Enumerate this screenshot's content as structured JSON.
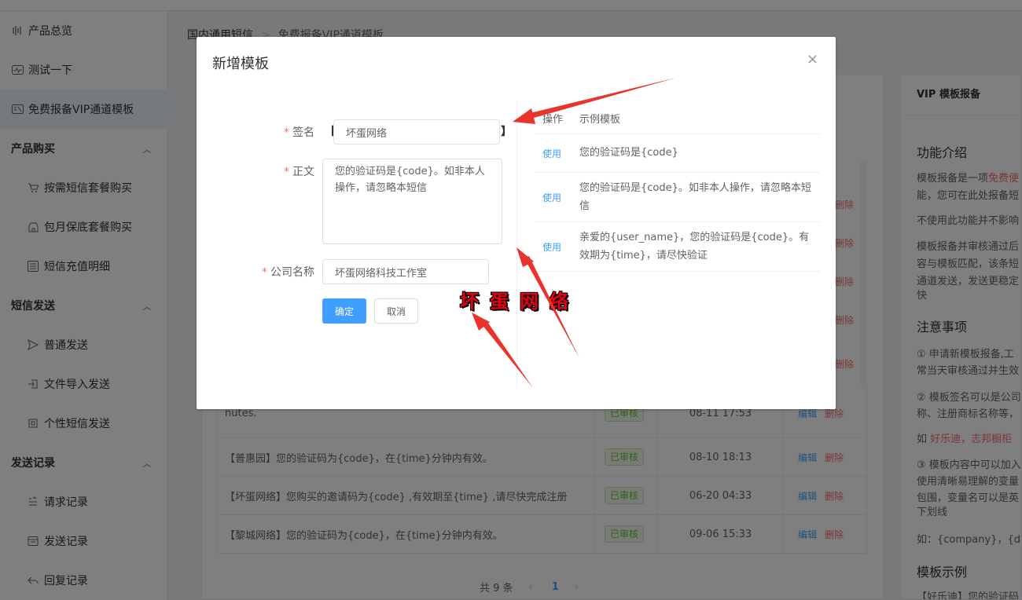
{
  "sidebar": {
    "items": [
      {
        "label": "产品总览",
        "icon": "bars-icon"
      },
      {
        "label": "测试一下",
        "icon": "pulse-icon"
      },
      {
        "label": "免费报备VIP通道模板",
        "icon": "template-icon"
      }
    ],
    "groups": [
      {
        "label": "产品购买",
        "items": [
          {
            "label": "按需短信套餐购买"
          },
          {
            "label": "包月保底套餐购买"
          },
          {
            "label": "短信充值明细"
          }
        ]
      },
      {
        "label": "短信发送",
        "items": [
          {
            "label": "普通发送"
          },
          {
            "label": "文件导入发送"
          },
          {
            "label": "个性短信发送"
          }
        ]
      },
      {
        "label": "发送记录",
        "items": [
          {
            "label": "请求记录"
          },
          {
            "label": "发送记录"
          },
          {
            "label": "回复记录"
          }
        ]
      }
    ]
  },
  "breadcrumb": {
    "root": "国内通用短信",
    "sep": ">",
    "current": "免费报备VIP通道模板"
  },
  "table": {
    "rows": [
      {
        "content": "nutes.",
        "status": "已审核",
        "time": "08-11 17:53",
        "edit": "编辑",
        "del": "删除"
      },
      {
        "content": "【普惠园】您的验证码为{code}，在{time}分钟内有效。",
        "status": "已审核",
        "time": "08-10 18:13",
        "edit": "编辑",
        "del": "删除"
      },
      {
        "content": "【坏蛋网络】您购买的邀请码为{code} ,有效期至{time} ,请尽快完成注册",
        "status": "已审核",
        "time": "06-20 04:33",
        "edit": "编辑",
        "del": "删除"
      },
      {
        "content": "【黎城网络】您的验证码为{code}，在{time}分钟内有效。",
        "status": "已审核",
        "time": "09-06 15:33",
        "edit": "编辑",
        "del": "删除"
      }
    ],
    "hidden_del": "删除"
  },
  "pagination": {
    "total": "共 9 条",
    "prev": "‹",
    "page": "1",
    "next": "›"
  },
  "right_panel": {
    "title": "VIP 模板报备",
    "intro_h": "功能介绍",
    "intro_1a": "模板报备是一项",
    "intro_1b": "免费便",
    "intro_1c": "能，您可在此处报备短",
    "intro_2": "不使用此功能并不影响",
    "intro_3a": "模板报备并审核通过后",
    "intro_3b": "容与模板匹配，该条短",
    "intro_3c": "通道发送，发送更稳定",
    "intro_3d": "快",
    "notes_h": "注意事项",
    "note_1a": "① 申请新模板报备,工",
    "note_1b": "常当天审核通过并生效",
    "note_2a": "② 模板签名可以是公司",
    "note_2b": "称、注册商标名称等，",
    "note_2c_prefix": "如",
    "note_2c_red": "好乐迪，志邦橱柜",
    "note_3a": "③ 模板内容中可以加入",
    "note_3b": "使用清晰易理解的变量",
    "note_3c": "包围，变量名可以是英",
    "note_3d": "下划线",
    "note_4": "如：{company}，{date",
    "example_h": "模板示例",
    "example_1": "【好乐迪】您的验证码"
  },
  "dialog": {
    "title": "新增模板",
    "close": "×",
    "sign_label": "签名",
    "sign_open": "【",
    "sign_close": "】",
    "sign_value": "坏蛋网络",
    "body_label": "正文",
    "body_value": "您的验证码是{code}。如非本人操作，请忽略本短信",
    "company_label": "公司名称",
    "company_value": "坏蛋网络科技工作室",
    "required_mark": "*",
    "ok": "确定",
    "cancel": "取消",
    "examples_head_op": "操作",
    "examples_head_tpl": "示例模板",
    "examples": [
      {
        "use": "使用",
        "text": "您的验证码是{code}"
      },
      {
        "use": "使用",
        "text": "您的验证码是{code}。如非本人操作，请忽略本短信"
      },
      {
        "use": "使用",
        "text": "亲爱的{user_name}，您的验证码是{code}。有效期为{time}，请尽快验证"
      }
    ]
  },
  "watermark": "坏蛋网络",
  "colors": {
    "primary": "#409eff",
    "danger": "#f56c6c",
    "success": "#67c23a",
    "arrow": "#e8342c"
  }
}
